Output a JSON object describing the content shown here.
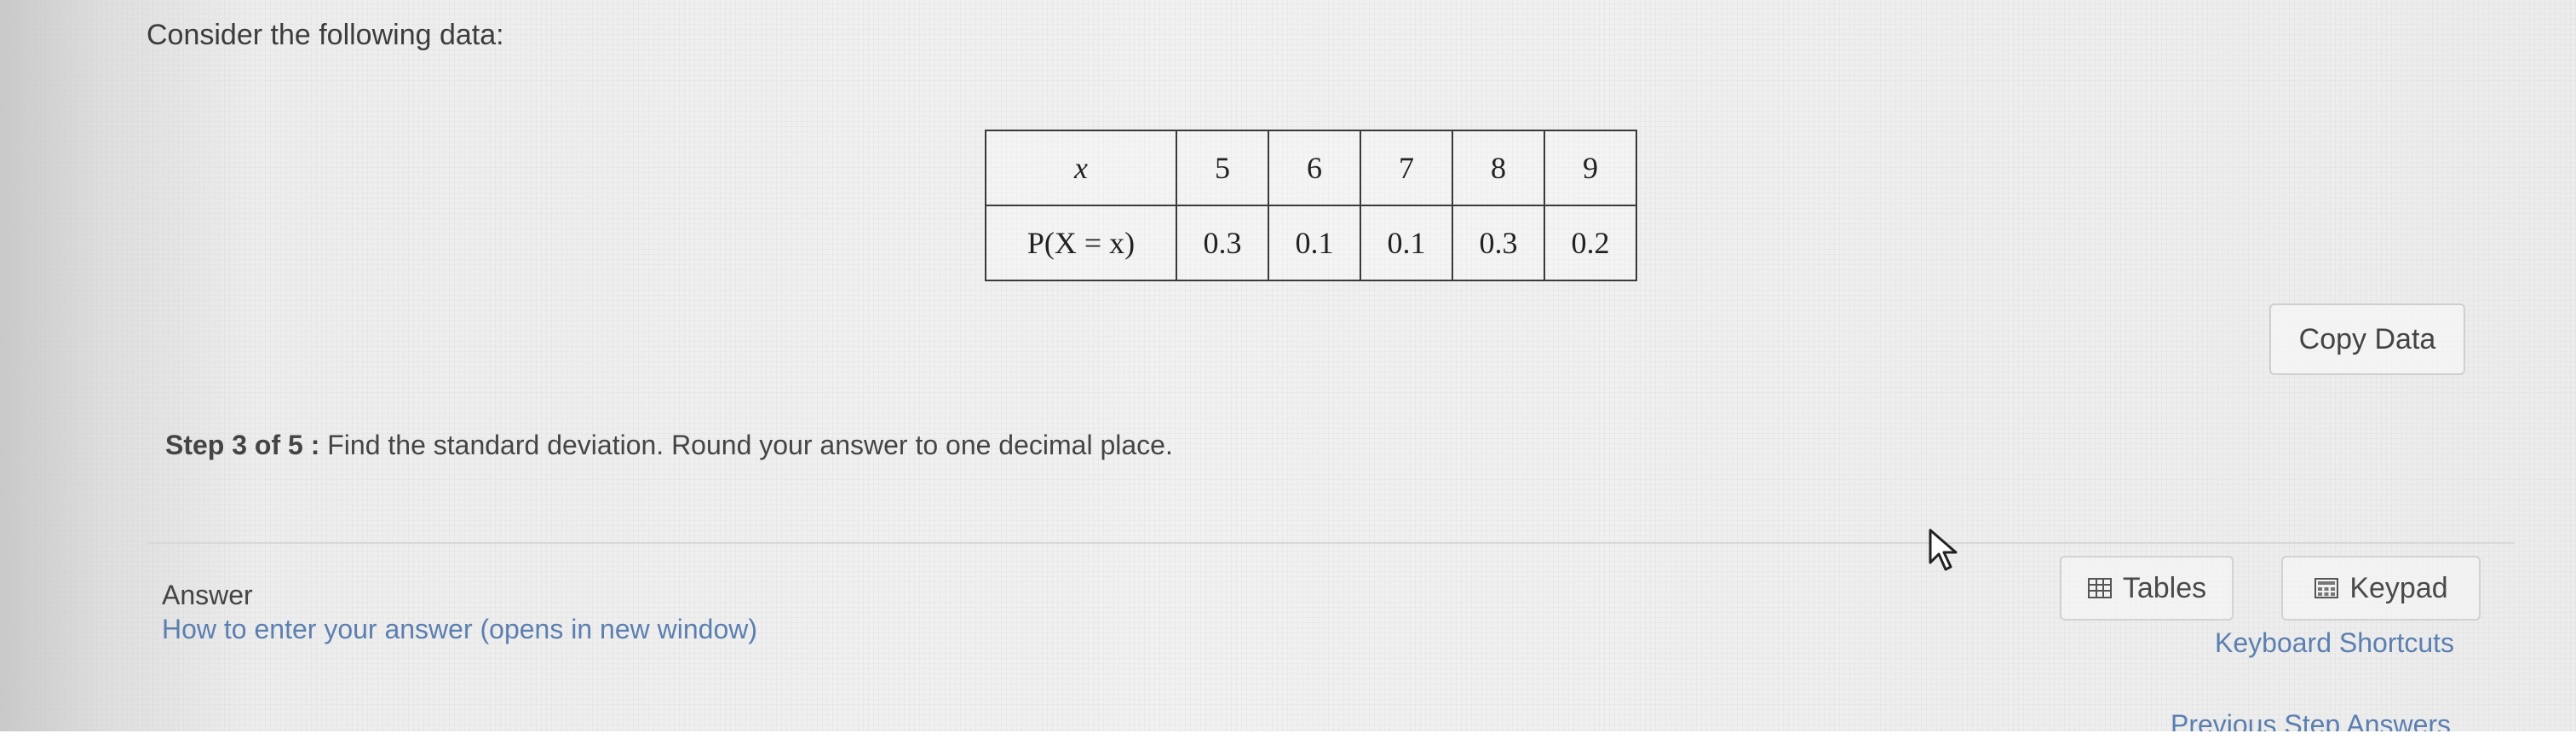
{
  "problem": {
    "prompt": "Consider the following data:"
  },
  "table": {
    "row_x_label": "x",
    "row_p_label": "P(X = x)",
    "x_values": [
      "5",
      "6",
      "7",
      "8",
      "9"
    ],
    "p_values": [
      "0.3",
      "0.1",
      "0.1",
      "0.3",
      "0.2"
    ]
  },
  "copy_data_label": "Copy Data",
  "step": {
    "label": "Step 3 of 5 :",
    "instruction": "Find the standard deviation. Round your answer to one decimal place."
  },
  "answer": {
    "title": "Answer",
    "help_link": "How to enter your answer (opens in new window)"
  },
  "tools": {
    "tables_label": "Tables",
    "keypad_label": "Keypad",
    "tables_icon": "table-grid-icon",
    "keypad_icon": "keypad-icon"
  },
  "links": {
    "keyboard_shortcuts": "Keyboard Shortcuts",
    "previous_step_answers": "Previous Step Answers"
  },
  "colors": {
    "link": "#5b7fb0",
    "text": "#3c3c3c"
  }
}
